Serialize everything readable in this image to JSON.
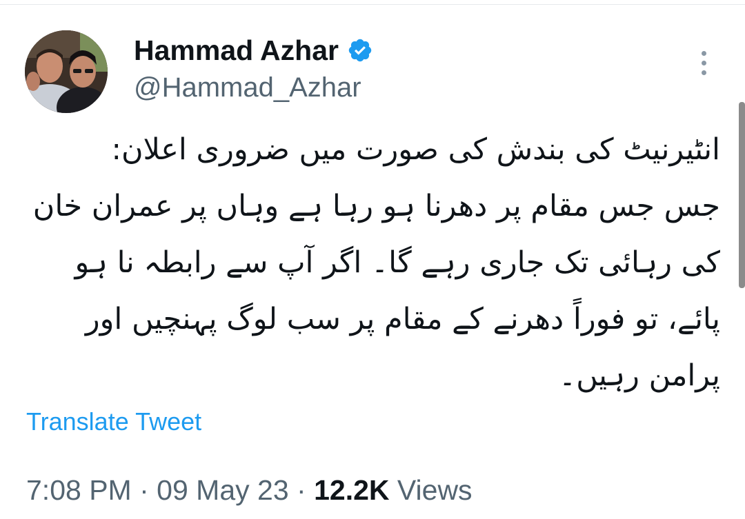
{
  "author": {
    "display_name": "Hammad Azhar",
    "handle": "@Hammad_Azhar",
    "verified": true,
    "verified_color": "#1d9bf0",
    "avatar_icon": "profile-photo"
  },
  "more_icon": "more-vertical-icon",
  "tweet": {
    "lines": [
      "انٹیرنیٹ کی بندش کی صورت میں ضروری اعلان:",
      "جس جس مقام پر دھرنا ہو رہا ہے وہاں پر عمران خان",
      "کی رہائی تک جاری رہے گا۔ اگر آپ سے رابطہ نا ہو",
      "پائے، تو فوراً دھرنے کے مقام پر سب لوگ پہنچیں اور",
      "پرامن رہیں۔"
    ]
  },
  "translate_label": "Translate Tweet",
  "meta": {
    "time": "7:08 PM",
    "separator": "·",
    "date": "09 May 23",
    "views_count": "12.2K",
    "views_label": "Views"
  },
  "colors": {
    "link": "#1d9bf0",
    "secondary_text": "#536471",
    "primary_text": "#0f1419"
  }
}
